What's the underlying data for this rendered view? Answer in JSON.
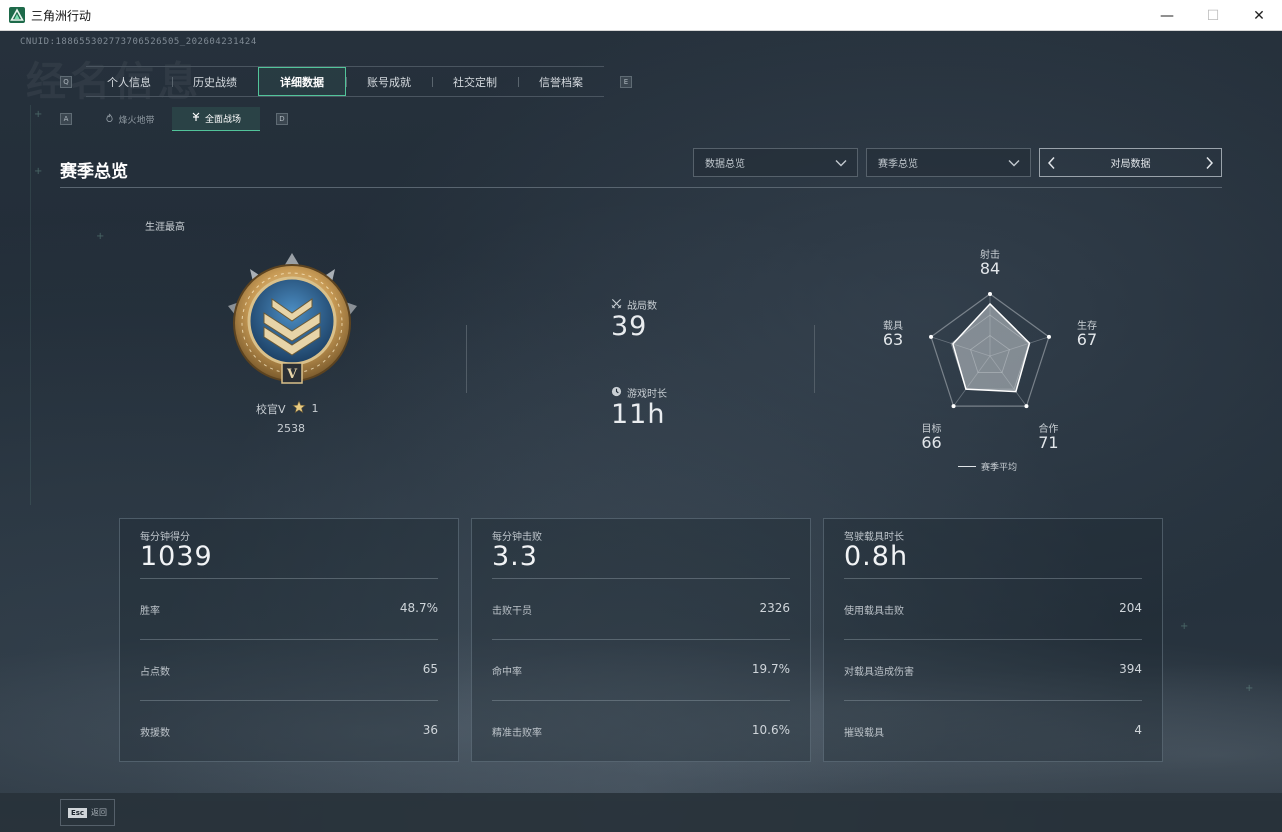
{
  "window": {
    "title": "三角洲行动",
    "minimize": "—",
    "maximize": "☐",
    "close": "✕"
  },
  "uid": "CNUID:18865530277370652650​5_202604231424",
  "background_title": "经名信息",
  "tabs": {
    "key_left": "Q",
    "key_right": "E",
    "items": [
      {
        "label": "个人信息"
      },
      {
        "label": "历史战绩"
      },
      {
        "label": "详细数据",
        "active": true
      },
      {
        "label": "账号成就"
      },
      {
        "label": "社交定制"
      },
      {
        "label": "信誉档案"
      }
    ]
  },
  "subtabs": {
    "key_left": "A",
    "key_right": "D",
    "items": [
      {
        "label": "烽火地带",
        "icon": "flame-icon"
      },
      {
        "label": "全面战场",
        "icon": "battlefield-icon",
        "active": true
      }
    ]
  },
  "section_title": "赛季总览",
  "filters": {
    "data_dropdown": "数据总览",
    "season_dropdown": "赛季总览",
    "pager_label": "对局数据"
  },
  "rank": {
    "career_label": "生涯最高",
    "name": "校官V",
    "stars": "1",
    "points": "2538",
    "badge_numeral": "V"
  },
  "center_stats": {
    "matches_label": "战局数",
    "matches_value": "39",
    "time_label": "游戏时长",
    "time_value": "11h"
  },
  "radar": {
    "axes": [
      {
        "label": "射击",
        "value": 84
      },
      {
        "label": "生存",
        "value": 67
      },
      {
        "label": "合作",
        "value": 71
      },
      {
        "label": "目标",
        "value": 66
      },
      {
        "label": "载具",
        "value": 63
      }
    ],
    "legend": "赛季平均"
  },
  "cards": [
    {
      "head_label": "每分钟得分",
      "head_value": "1039",
      "rows": [
        {
          "k": "胜率",
          "v": "48.7%"
        },
        {
          "k": "占点数",
          "v": "65"
        },
        {
          "k": "救援数",
          "v": "36"
        }
      ]
    },
    {
      "head_label": "每分钟击败",
      "head_value": "3.3",
      "rows": [
        {
          "k": "击败干员",
          "v": "2326"
        },
        {
          "k": "命中率",
          "v": "19.7%"
        },
        {
          "k": "精准击败率",
          "v": "10.6%"
        }
      ]
    },
    {
      "head_label": "驾驶载具时长",
      "head_value": "0.8h",
      "rows": [
        {
          "k": "使用载具击败",
          "v": "204"
        },
        {
          "k": "对载具造成伤害",
          "v": "394"
        },
        {
          "k": "摧毁载具",
          "v": "4"
        }
      ]
    }
  ],
  "footer": {
    "esc_key": "Esc",
    "back_label": "返回"
  },
  "colors": {
    "accent": "#52c49a",
    "background": "#222d38",
    "text": "#d8dde2"
  }
}
